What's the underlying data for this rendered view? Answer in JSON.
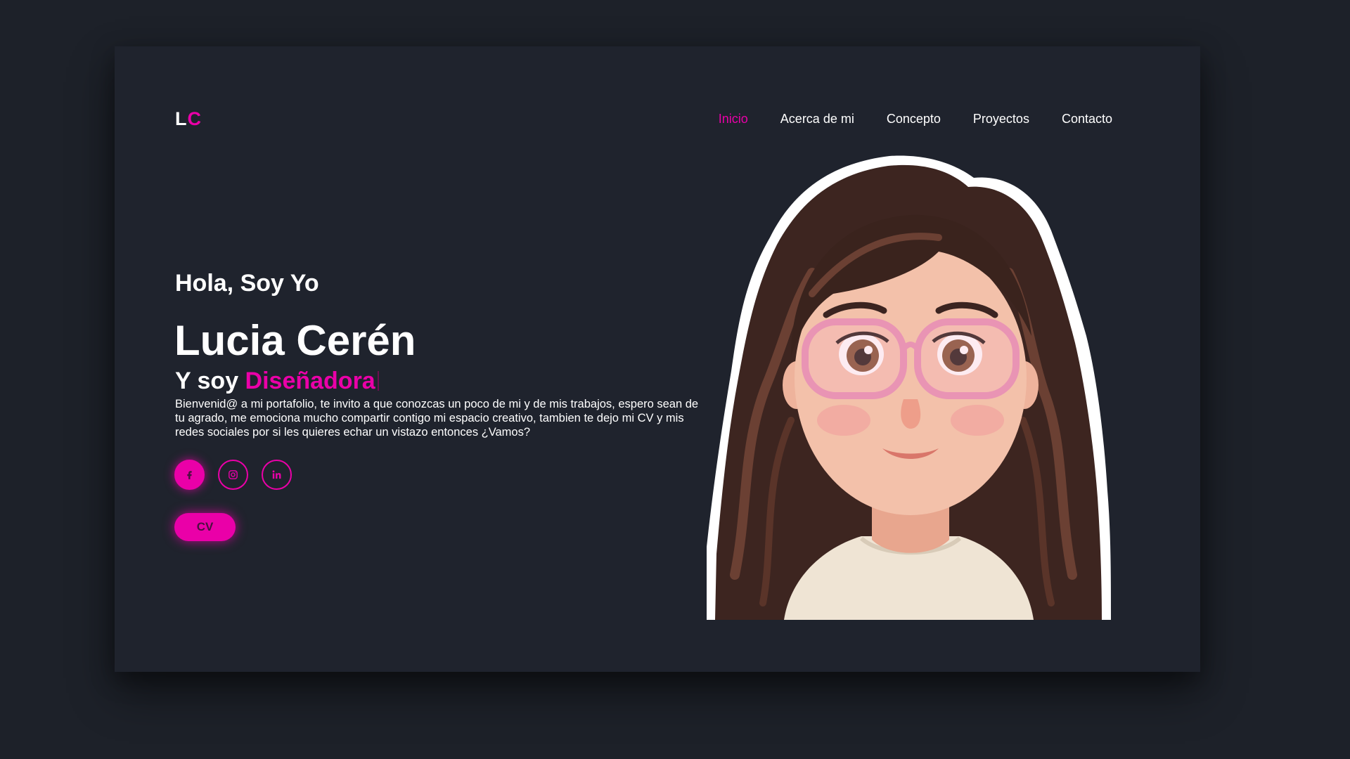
{
  "logo": {
    "first": "L",
    "second": "C"
  },
  "nav": {
    "items": [
      {
        "label": "Inicio",
        "active": true
      },
      {
        "label": "Acerca de mi",
        "active": false
      },
      {
        "label": "Concepto",
        "active": false
      },
      {
        "label": "Proyectos",
        "active": false
      },
      {
        "label": "Contacto",
        "active": false
      }
    ]
  },
  "hero": {
    "greeting": "Hola, Soy Yo",
    "name": "Lucia Cerén",
    "role_prefix": "Y soy ",
    "role": "Diseñadora",
    "intro": "Bienvenid@ a mi portafolio, te invito a que conozcas un poco de mi y de mis trabajos, espero sean de tu agrado, me emociona mucho compartir contigo mi espacio creativo, tambien te dejo mi CV y mis redes sociales por si les quieres echar un vistazo entonces ¿Vamos?",
    "cv_label": "CV"
  },
  "socials": [
    {
      "icon": "facebook-icon",
      "filled": true
    },
    {
      "icon": "instagram-icon",
      "filled": false
    },
    {
      "icon": "linkedin-icon",
      "filled": false
    }
  ],
  "colors": {
    "accent": "#ea00a8",
    "background": "#1f232d",
    "text": "#ffffff"
  }
}
